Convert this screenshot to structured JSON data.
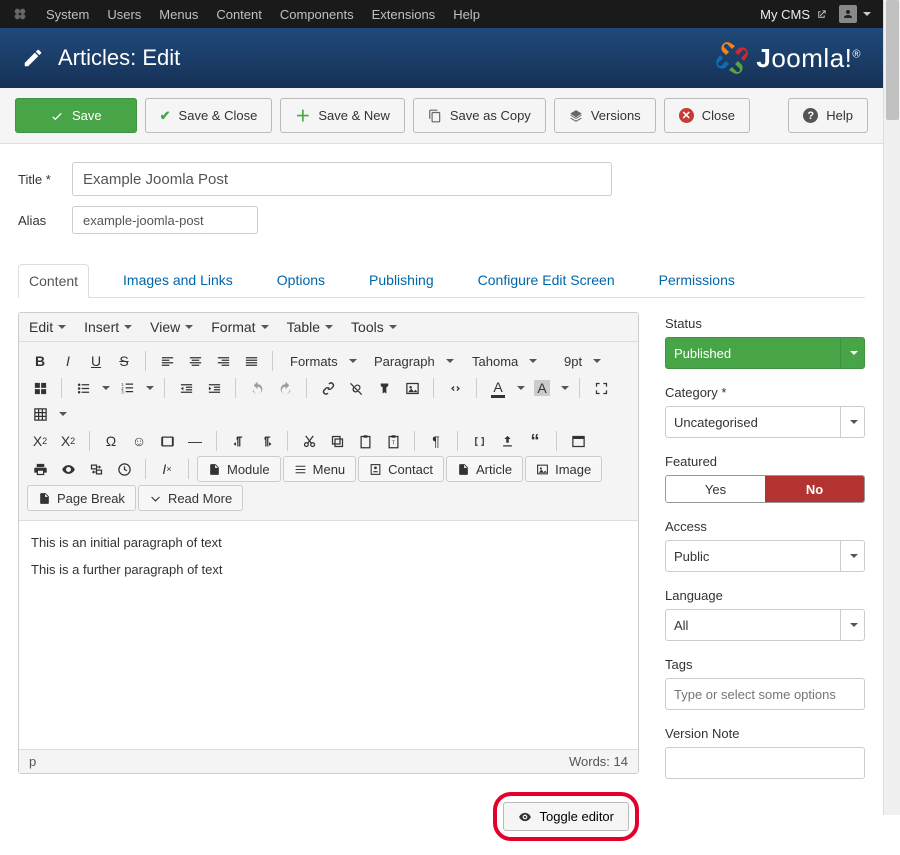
{
  "admin_menu": [
    "System",
    "Users",
    "Menus",
    "Content",
    "Components",
    "Extensions",
    "Help"
  ],
  "site_name": "My CMS",
  "page_title": "Articles: Edit",
  "brand": "Joomla!",
  "toolbar": {
    "save": "Save",
    "save_close": "Save & Close",
    "save_new": "Save & New",
    "save_copy": "Save as Copy",
    "versions": "Versions",
    "close": "Close",
    "help": "Help"
  },
  "form": {
    "title_label": "Title *",
    "title_value": "Example Joomla Post",
    "alias_label": "Alias",
    "alias_value": "example-joomla-post"
  },
  "tabs": [
    "Content",
    "Images and Links",
    "Options",
    "Publishing",
    "Configure Edit Screen",
    "Permissions"
  ],
  "active_tab_index": 0,
  "editor": {
    "menus": [
      "Edit",
      "Insert",
      "View",
      "Format",
      "Table",
      "Tools"
    ],
    "formats_label": "Formats",
    "paragraph_label": "Paragraph",
    "font_family": "Tahoma",
    "font_size": "9pt",
    "module_btn": "Module",
    "menu_btn": "Menu",
    "contact_btn": "Contact",
    "article_btn": "Article",
    "image_btn": "Image",
    "pagebreak_btn": "Page Break",
    "readmore_btn": "Read More",
    "body_p1": "This is an initial paragraph of text",
    "body_p2": "This is a further paragraph of text",
    "status_path": "p",
    "word_count_label": "Words: 14"
  },
  "toggle_editor_label": "Toggle editor",
  "sidebar": {
    "status_label": "Status",
    "status_value": "Published",
    "category_label": "Category *",
    "category_value": "Uncategorised",
    "featured_label": "Featured",
    "featured_yes": "Yes",
    "featured_no": "No",
    "access_label": "Access",
    "access_value": "Public",
    "language_label": "Language",
    "language_value": "All",
    "tags_label": "Tags",
    "tags_placeholder": "Type or select some options",
    "version_note_label": "Version Note"
  }
}
